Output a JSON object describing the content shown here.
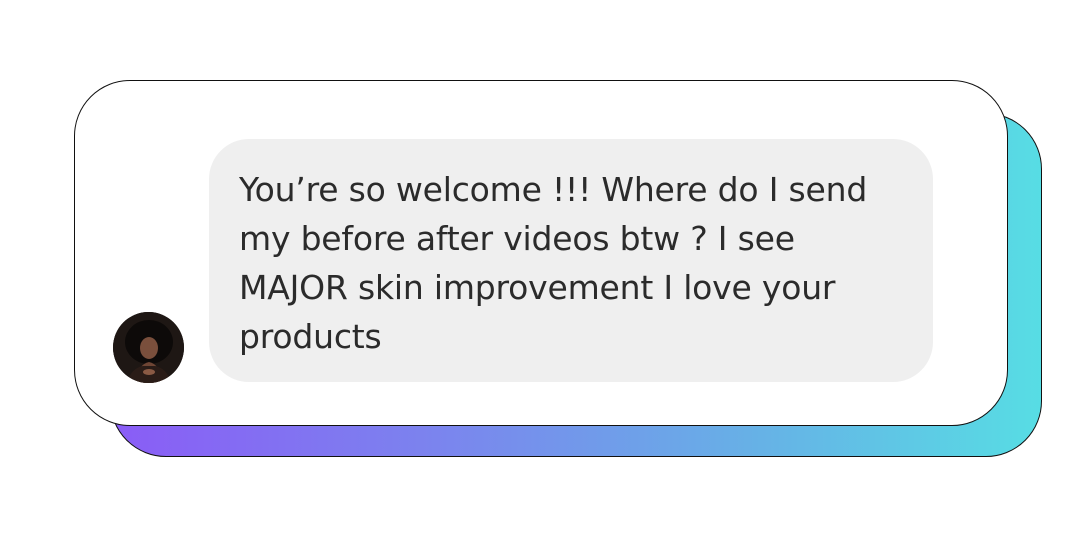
{
  "conversation": {
    "message": {
      "text": "You’re so welcome !!! Where do I send my before after videos btw ? I see MAJOR skin improvement I love your products",
      "sender_avatar": "profile-photo"
    }
  },
  "colors": {
    "bubble_background": "#efefef",
    "card_background": "#ffffff",
    "gradient_start": "#8a5cf6",
    "gradient_end": "#57dde4",
    "outline": "#111111"
  }
}
